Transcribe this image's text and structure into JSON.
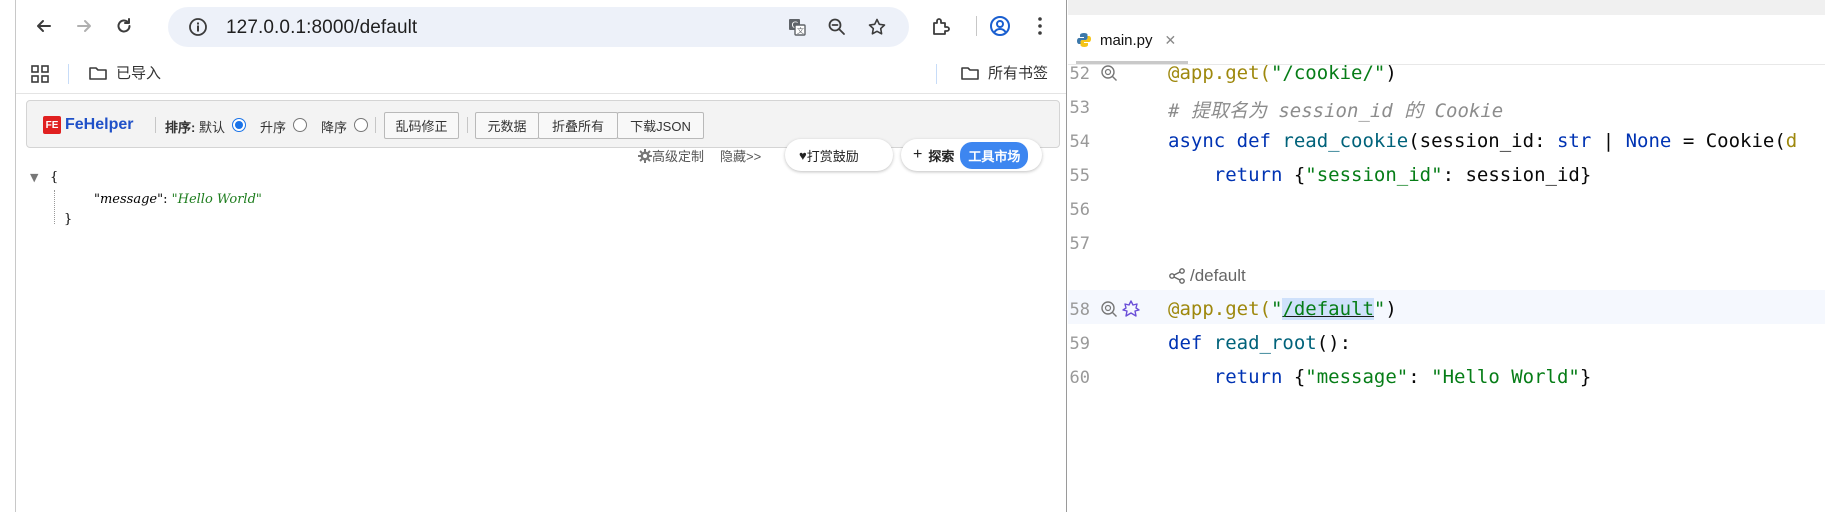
{
  "browser": {
    "url": "127.0.0.1:8000/default",
    "bookmarks": {
      "imported": "已导入",
      "all_bookmarks": "所有书签"
    }
  },
  "fehelper": {
    "logo": "FeHelper",
    "sort_label": "排序:",
    "sort_default": "默认",
    "sort_asc": "升序",
    "sort_desc": "降序",
    "fix_encoding": "乱码修正",
    "raw_data": "元数据",
    "collapse_all": "折叠所有",
    "download_json": "下载JSON",
    "advanced": "高级定制",
    "hide": "隐藏>>",
    "donate": "打赏鼓励",
    "explore": "探索",
    "market": "工具市场",
    "sort_selected": "默认"
  },
  "json_view": {
    "open_brace": "{",
    "key": "\"message\"",
    "colon": ":",
    "value": "\"Hello World\"",
    "close_brace": "}"
  },
  "ide": {
    "tab_name": "main.py",
    "lines": [
      {
        "num": "52",
        "text": ""
      },
      {
        "num": "53",
        "text": ""
      },
      {
        "num": "54",
        "text": ""
      },
      {
        "num": "55",
        "text": ""
      },
      {
        "num": "56",
        "text": ""
      },
      {
        "num": "57",
        "text": ""
      },
      {
        "num": "58",
        "text": ""
      },
      {
        "num": "59",
        "text": ""
      },
      {
        "num": "60",
        "text": ""
      }
    ],
    "endpoint_hint": "/default",
    "code": {
      "l52_dec": "@app.get(",
      "l52_str": "\"/cookie/\"",
      "l52_end": ")",
      "l53_comment": "# 提取名为 session_id 的 Cookie",
      "l54_kw": "async def ",
      "l54_fn": "read_cookie",
      "l54_rest": "(session_id: ",
      "l54_type": "str",
      "l54_pipe": " | ",
      "l54_none": "None",
      "l54_tail": " = Cookie(",
      "l54_tail2": "d",
      "l55_kw": "return ",
      "l55_open": "{",
      "l55_str": "\"session_id\"",
      "l55_rest": ": session_id}",
      "l58_dec": "@app.get(",
      "l58_q1": "\"",
      "l58_path": "/default",
      "l58_q2": "\"",
      "l58_end": ")",
      "l59_kw": "def ",
      "l59_fn": "read_root",
      "l59_rest": "():",
      "l60_kw": "return ",
      "l60_open": "{",
      "l60_key": "\"message\"",
      "l60_colon": ": ",
      "l60_val": "\"Hello World\"",
      "l60_close": "}"
    }
  }
}
